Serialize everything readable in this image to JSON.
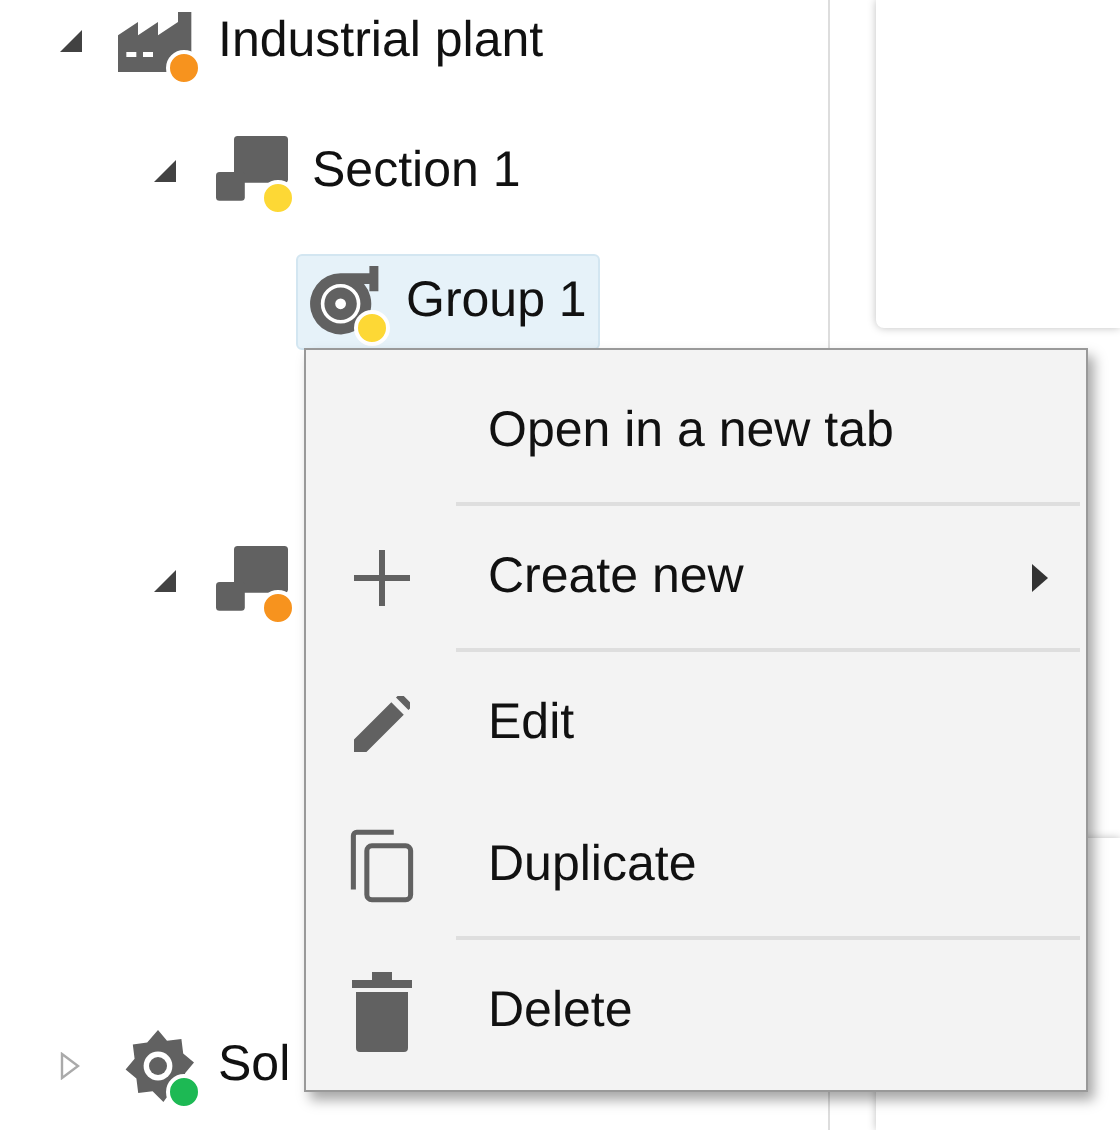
{
  "tree": [
    {
      "label": "Industrial plant",
      "kind": "plant",
      "color": "#f7931e",
      "expanded": true,
      "selected": false,
      "children": [
        {
          "label": "Section 1",
          "kind": "section",
          "color": "#fdd835",
          "expanded": true,
          "selected": false,
          "children": [
            {
              "label": "Group 1",
              "kind": "group",
              "color": "#fdd835",
              "selected": true
            }
          ]
        },
        {
          "kind": "section",
          "color": "#f7931e",
          "expanded": true,
          "selected": false
        }
      ]
    },
    {
      "label": "Sol",
      "kind": "site",
      "color": "#1db954",
      "expanded": false,
      "selected": false
    }
  ],
  "context_menu": [
    {
      "label": "Open in a new tab",
      "kind": "open",
      "submenu": false,
      "divider_after": true
    },
    {
      "label": "Create new",
      "kind": "create",
      "submenu": true,
      "divider_after": true
    },
    {
      "label": "Edit",
      "kind": "edit",
      "submenu": false,
      "divider_after": false
    },
    {
      "label": "Duplicate",
      "kind": "duplicate",
      "submenu": false,
      "divider_after": true
    },
    {
      "label": "Delete",
      "kind": "delete",
      "submenu": false,
      "divider_after": false
    }
  ]
}
